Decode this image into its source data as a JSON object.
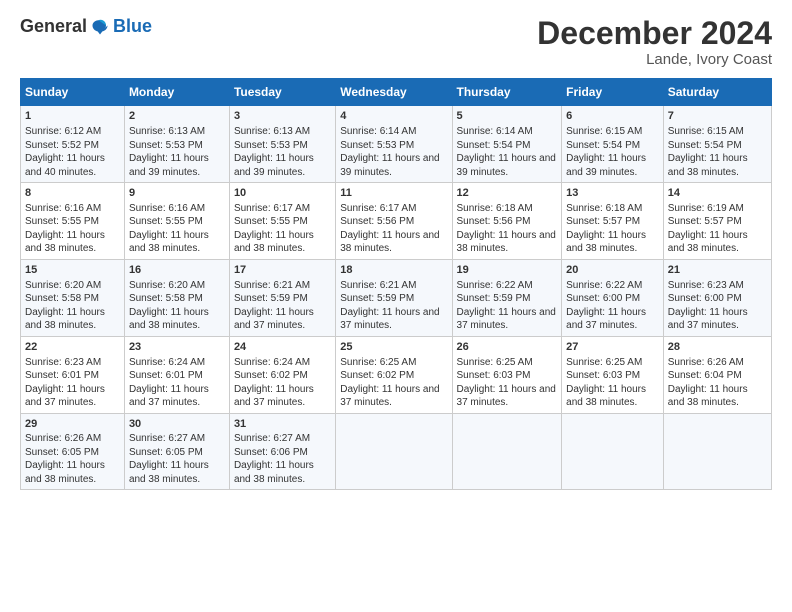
{
  "logo": {
    "general": "General",
    "blue": "Blue"
  },
  "title": "December 2024",
  "subtitle": "Lande, Ivory Coast",
  "header_days": [
    "Sunday",
    "Monday",
    "Tuesday",
    "Wednesday",
    "Thursday",
    "Friday",
    "Saturday"
  ],
  "weeks": [
    [
      {
        "day": "1",
        "sunrise": "6:12 AM",
        "sunset": "5:52 PM",
        "daylight": "11 hours and 40 minutes."
      },
      {
        "day": "2",
        "sunrise": "6:13 AM",
        "sunset": "5:53 PM",
        "daylight": "11 hours and 39 minutes."
      },
      {
        "day": "3",
        "sunrise": "6:13 AM",
        "sunset": "5:53 PM",
        "daylight": "11 hours and 39 minutes."
      },
      {
        "day": "4",
        "sunrise": "6:14 AM",
        "sunset": "5:53 PM",
        "daylight": "11 hours and 39 minutes."
      },
      {
        "day": "5",
        "sunrise": "6:14 AM",
        "sunset": "5:54 PM",
        "daylight": "11 hours and 39 minutes."
      },
      {
        "day": "6",
        "sunrise": "6:15 AM",
        "sunset": "5:54 PM",
        "daylight": "11 hours and 39 minutes."
      },
      {
        "day": "7",
        "sunrise": "6:15 AM",
        "sunset": "5:54 PM",
        "daylight": "11 hours and 38 minutes."
      }
    ],
    [
      {
        "day": "8",
        "sunrise": "6:16 AM",
        "sunset": "5:55 PM",
        "daylight": "11 hours and 38 minutes."
      },
      {
        "day": "9",
        "sunrise": "6:16 AM",
        "sunset": "5:55 PM",
        "daylight": "11 hours and 38 minutes."
      },
      {
        "day": "10",
        "sunrise": "6:17 AM",
        "sunset": "5:55 PM",
        "daylight": "11 hours and 38 minutes."
      },
      {
        "day": "11",
        "sunrise": "6:17 AM",
        "sunset": "5:56 PM",
        "daylight": "11 hours and 38 minutes."
      },
      {
        "day": "12",
        "sunrise": "6:18 AM",
        "sunset": "5:56 PM",
        "daylight": "11 hours and 38 minutes."
      },
      {
        "day": "13",
        "sunrise": "6:18 AM",
        "sunset": "5:57 PM",
        "daylight": "11 hours and 38 minutes."
      },
      {
        "day": "14",
        "sunrise": "6:19 AM",
        "sunset": "5:57 PM",
        "daylight": "11 hours and 38 minutes."
      }
    ],
    [
      {
        "day": "15",
        "sunrise": "6:20 AM",
        "sunset": "5:58 PM",
        "daylight": "11 hours and 38 minutes."
      },
      {
        "day": "16",
        "sunrise": "6:20 AM",
        "sunset": "5:58 PM",
        "daylight": "11 hours and 38 minutes."
      },
      {
        "day": "17",
        "sunrise": "6:21 AM",
        "sunset": "5:59 PM",
        "daylight": "11 hours and 37 minutes."
      },
      {
        "day": "18",
        "sunrise": "6:21 AM",
        "sunset": "5:59 PM",
        "daylight": "11 hours and 37 minutes."
      },
      {
        "day": "19",
        "sunrise": "6:22 AM",
        "sunset": "5:59 PM",
        "daylight": "11 hours and 37 minutes."
      },
      {
        "day": "20",
        "sunrise": "6:22 AM",
        "sunset": "6:00 PM",
        "daylight": "11 hours and 37 minutes."
      },
      {
        "day": "21",
        "sunrise": "6:23 AM",
        "sunset": "6:00 PM",
        "daylight": "11 hours and 37 minutes."
      }
    ],
    [
      {
        "day": "22",
        "sunrise": "6:23 AM",
        "sunset": "6:01 PM",
        "daylight": "11 hours and 37 minutes."
      },
      {
        "day": "23",
        "sunrise": "6:24 AM",
        "sunset": "6:01 PM",
        "daylight": "11 hours and 37 minutes."
      },
      {
        "day": "24",
        "sunrise": "6:24 AM",
        "sunset": "6:02 PM",
        "daylight": "11 hours and 37 minutes."
      },
      {
        "day": "25",
        "sunrise": "6:25 AM",
        "sunset": "6:02 PM",
        "daylight": "11 hours and 37 minutes."
      },
      {
        "day": "26",
        "sunrise": "6:25 AM",
        "sunset": "6:03 PM",
        "daylight": "11 hours and 37 minutes."
      },
      {
        "day": "27",
        "sunrise": "6:25 AM",
        "sunset": "6:03 PM",
        "daylight": "11 hours and 38 minutes."
      },
      {
        "day": "28",
        "sunrise": "6:26 AM",
        "sunset": "6:04 PM",
        "daylight": "11 hours and 38 minutes."
      }
    ],
    [
      {
        "day": "29",
        "sunrise": "6:26 AM",
        "sunset": "6:05 PM",
        "daylight": "11 hours and 38 minutes."
      },
      {
        "day": "30",
        "sunrise": "6:27 AM",
        "sunset": "6:05 PM",
        "daylight": "11 hours and 38 minutes."
      },
      {
        "day": "31",
        "sunrise": "6:27 AM",
        "sunset": "6:06 PM",
        "daylight": "11 hours and 38 minutes."
      },
      null,
      null,
      null,
      null
    ]
  ]
}
